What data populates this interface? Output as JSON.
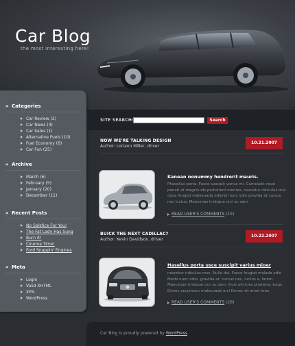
{
  "header": {
    "title": "Car Blog",
    "tagline": "the most interesting here!"
  },
  "sidebar": {
    "categories": {
      "heading": "Categories",
      "items": [
        "Car Review (2)",
        "Car News (4)",
        "Car Sales (1)",
        "Alternative Fuels (10)",
        "Fuel Economy (6)",
        "Car Fun (25)"
      ]
    },
    "archive": {
      "heading": "Archive",
      "items": [
        "March (6)",
        "February (5)",
        "January (20)",
        "December (11)"
      ]
    },
    "recent_posts": {
      "heading": "Recent Posts",
      "items": [
        "No Solstice For You!",
        "The Fat Lady Has Sung",
        "Burn It!",
        "Cinema Time!",
        "Ford Snappin' Engines"
      ]
    },
    "meta": {
      "heading": "Meta",
      "items": [
        "Login",
        "Valid XHTML",
        "XFN",
        "WordPress"
      ]
    }
  },
  "search": {
    "label": "SITE SEARCH:",
    "value": "",
    "button": "Search"
  },
  "posts": [
    {
      "title": "NOW WE'RE TALKING DESIGN",
      "author": "Author: Loriann Miller, driver",
      "date": "10.21.2007",
      "subtitle": "Kanean nonummy hendrerit mauris.",
      "excerpt": "Phasellus porta. Fusce suscipit varius mi. Cumciads nque penati et magnis dis parturient montes, nascetur ridiculus mla duce feugiat malesuada odiorbi nunc odio gravida at cursus nec luctus. Maecenas tristique orci ac sem.",
      "comments_label": "READ USER'S COMMENTS",
      "comments_count": "(15)"
    },
    {
      "title": "BUICK THE NEXT CADILLAC?",
      "author": "Author: Kevin Davidson, driver",
      "date": "10.22.2007",
      "subtitle": "Hasellus porta usce suscipit varius mioer",
      "excerpt": "nascetur ridiculus mus. Nulla dui. Fusce feugiat malada odio Morbi nunc odio, gravida at, cursus nec, luctus a, lorem. Maecenas tristique orci ac sem. Duis ultricies pharetra magn. Donec accumsan malesuada orci Donec sit amet eros.",
      "comments_label": "READ USER'S COMMENTS",
      "comments_count": "(28)"
    }
  ],
  "footer": {
    "text": "Car Blog is proudly powered by",
    "link": "WordPress"
  },
  "colors": {
    "accent": "#b01a24",
    "sidebar": "#555a61",
    "background": "#2a2e33"
  }
}
